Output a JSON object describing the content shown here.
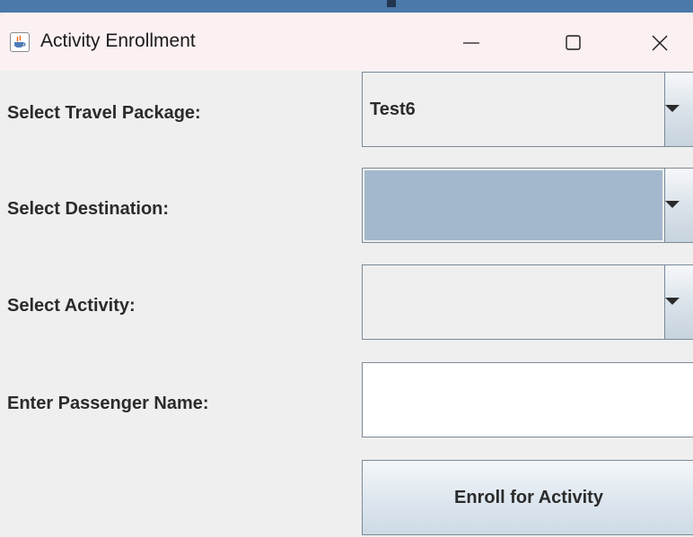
{
  "window": {
    "title": "Activity Enrollment",
    "icon": "java-cup-icon",
    "controls": [
      "minimize-icon",
      "maximize-icon",
      "close-icon"
    ]
  },
  "form": {
    "travel_package": {
      "label": "Select Travel Package:",
      "selected": "Test6"
    },
    "destination": {
      "label": "Select Destination:",
      "selected": ""
    },
    "activity": {
      "label": "Select Activity:",
      "selected": ""
    },
    "passenger_name": {
      "label": "Enter Passenger Name:",
      "value": ""
    },
    "enroll_button": {
      "label": "Enroll for Activity"
    }
  },
  "colors": {
    "window_background": "#efefef",
    "titlebar_background": "#fbf0f2",
    "selected_highlight": "#a3b8cc",
    "border": "#7a8a99",
    "desktop_accent": "#4b79aa"
  }
}
